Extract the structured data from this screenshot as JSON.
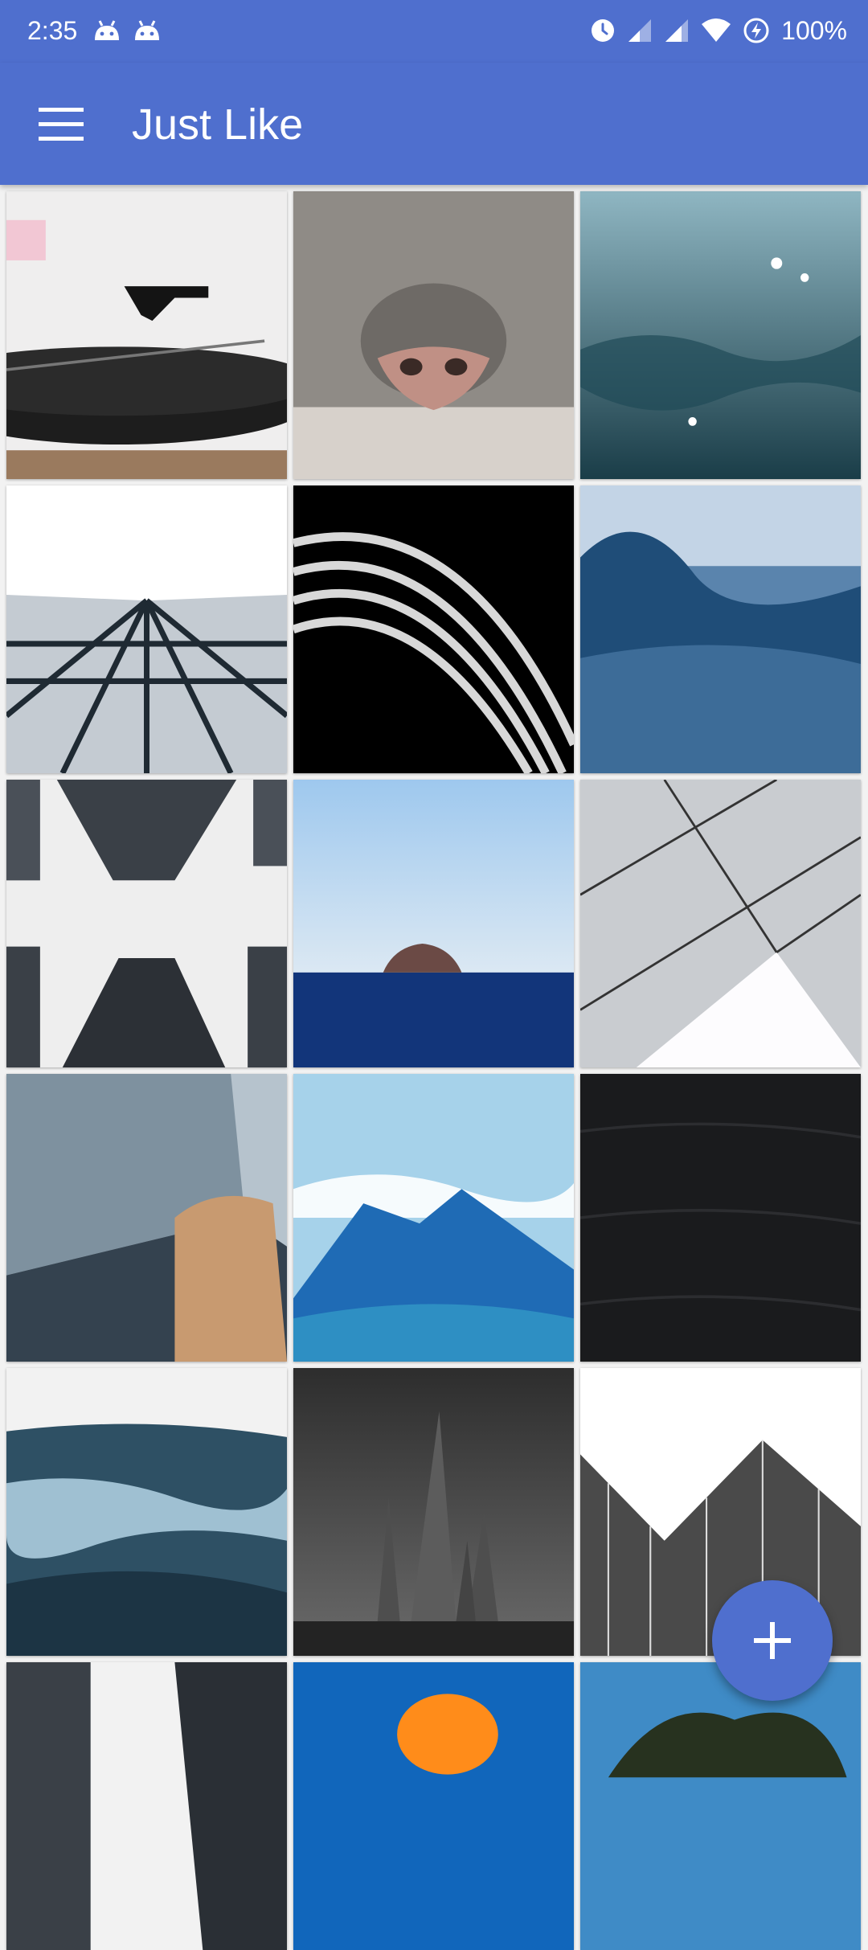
{
  "status_bar": {
    "time": "2:35",
    "notification_icons": [
      "android-icon",
      "android-icon"
    ],
    "system_icons": [
      "alarm-icon",
      "signal-icon",
      "signal-icon",
      "wifi-icon",
      "battery-saver-icon"
    ],
    "battery": "100%"
  },
  "app_bar": {
    "menu_icon": "hamburger-menu-icon",
    "title": "Just Like"
  },
  "grid": {
    "columns": 3,
    "tiles": [
      {
        "subject": "turntable",
        "colors": [
          "#f0eeee",
          "#202020"
        ]
      },
      {
        "subject": "cat-nose",
        "colors": [
          "#8e8a85",
          "#c8a095"
        ]
      },
      {
        "subject": "water-surface",
        "colors": [
          "#6b99a6",
          "#1c3d48"
        ]
      },
      {
        "subject": "building-facade",
        "colors": [
          "#ffffff",
          "#25303a"
        ]
      },
      {
        "subject": "curved-architecture",
        "colors": [
          "#000000",
          "#dcdcdc"
        ]
      },
      {
        "subject": "ocean-wave",
        "colors": [
          "#1f4d78",
          "#9dbad8"
        ]
      },
      {
        "subject": "skyscrapers",
        "colors": [
          "#eeeeee",
          "#2c3036"
        ]
      },
      {
        "subject": "island-sea",
        "colors": [
          "#a8cdee",
          "#12357a"
        ]
      },
      {
        "subject": "geometric-building",
        "colors": [
          "#c9ccd0",
          "#fdfcfe"
        ]
      },
      {
        "subject": "metal-architecture",
        "colors": [
          "#34424f",
          "#b6c3cd"
        ]
      },
      {
        "subject": "mountains-clouds",
        "colors": [
          "#7fbde0",
          "#1f6bb5"
        ]
      },
      {
        "subject": "dark-sand",
        "colors": [
          "#1a1b1d",
          "#242528"
        ]
      },
      {
        "subject": "rocky-water",
        "colors": [
          "#2e5064",
          "#f2f2f2"
        ]
      },
      {
        "subject": "rock-spires",
        "colors": [
          "#4a4a4a",
          "#202020"
        ]
      },
      {
        "subject": "glass-building",
        "colors": [
          "#ffffff",
          "#2b2b2b"
        ]
      },
      {
        "subject": "building-partial",
        "colors": [
          "#f2f2f2",
          "#2a2f35"
        ]
      },
      {
        "subject": "orange-object",
        "colors": [
          "#1166bb",
          "#ff8c1a"
        ]
      },
      {
        "subject": "tree-sky",
        "colors": [
          "#3f8bc6",
          "#27321f"
        ]
      }
    ]
  },
  "fab": {
    "icon": "add-icon"
  }
}
